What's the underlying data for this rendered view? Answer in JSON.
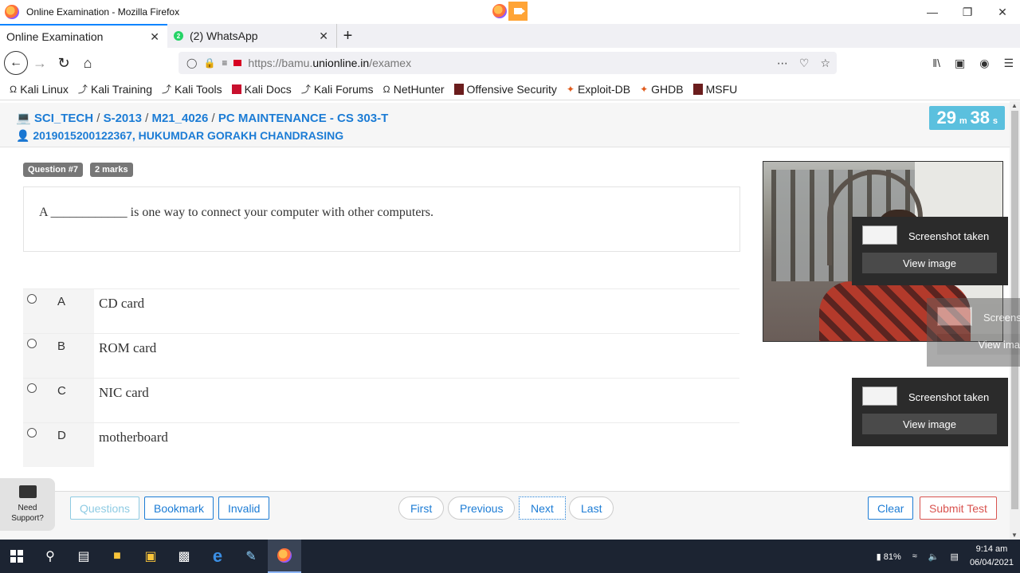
{
  "window": {
    "title": "Online Examination - Mozilla Firefox"
  },
  "tabs": [
    {
      "label": "Online Examination"
    },
    {
      "label": "(2) WhatsApp",
      "badge": "2"
    }
  ],
  "address": {
    "prefix": "https://bamu.",
    "domain": "unionline.in",
    "path": "/examex"
  },
  "bookmarks": [
    "Kali Linux",
    "Kali Training",
    "Kali Tools",
    "Kali Docs",
    "Kali Forums",
    "NetHunter",
    "Offensive Security",
    "Exploit-DB",
    "GHDB",
    "MSFU"
  ],
  "exam": {
    "crumbs": [
      "SCI_TECH",
      "S-2013",
      "M21_4026",
      "PC MAINTENANCE - CS 303-T"
    ],
    "student": "2019015200122367, HUKUMDAR GORAKH CHANDRASING",
    "timer": {
      "minutes": "29",
      "m_label": "m",
      "seconds": "38",
      "s_label": "s"
    },
    "question_badge": "Question #7",
    "marks_badge": "2 marks",
    "question": "A ____________ is one way to connect your computer with other computers.",
    "options": [
      {
        "letter": "A",
        "text": "CD card"
      },
      {
        "letter": "B",
        "text": "ROM card"
      },
      {
        "letter": "C",
        "text": "NIC card"
      },
      {
        "letter": "D",
        "text": "motherboard"
      }
    ]
  },
  "toasts": [
    {
      "text": "Screenshot taken",
      "button": "View image"
    },
    {
      "text": "Screens",
      "button": "View ima"
    },
    {
      "text": "Screenshot taken",
      "button": "View image"
    }
  ],
  "footer": {
    "questions": "Questions",
    "bookmark": "Bookmark",
    "invalid": "Invalid",
    "first": "First",
    "previous": "Previous",
    "next": "Next",
    "last": "Last",
    "clear": "Clear",
    "submit": "Submit Test"
  },
  "support": {
    "line1": "Need",
    "line2": "Support?"
  },
  "taskbar": {
    "battery": "81%",
    "time": "9:14 am",
    "date": "06/04/2021"
  },
  "colors": {
    "link": "#1c7cd5",
    "timer": "#5bc0de",
    "danger": "#d9534f",
    "badge": "#777777"
  }
}
